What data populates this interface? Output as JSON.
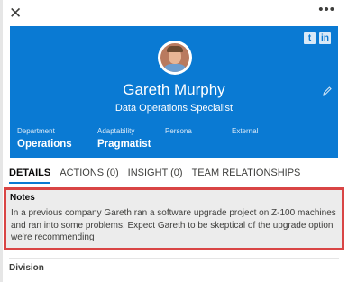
{
  "window": {
    "close_glyph": "✕",
    "more_glyph": "•••"
  },
  "header": {
    "social": [
      "t",
      "in"
    ],
    "name": "Gareth Murphy",
    "title": "Data Operations Specialist",
    "fields": [
      {
        "label": "Department",
        "value": "Operations"
      },
      {
        "label": "Adaptability",
        "value": "Pragmatist"
      },
      {
        "label": "Persona",
        "value": ""
      },
      {
        "label": "External",
        "value": ""
      }
    ],
    "accent": "#0a7ad3"
  },
  "tabs": [
    {
      "label": "DETAILS",
      "active": true
    },
    {
      "label": "ACTIONS (0)",
      "active": false
    },
    {
      "label": "INSIGHT (0)",
      "active": false
    },
    {
      "label": "TEAM RELATIONSHIPS",
      "active": false
    }
  ],
  "notes": {
    "title": "Notes",
    "text": "In a previous company Gareth ran a software upgrade project on Z-100 machines and ran into some problems. Expect Gareth to be skeptical of the upgrade option we're recommending",
    "highlight_color": "#d94545"
  },
  "division": {
    "label": "Division"
  }
}
